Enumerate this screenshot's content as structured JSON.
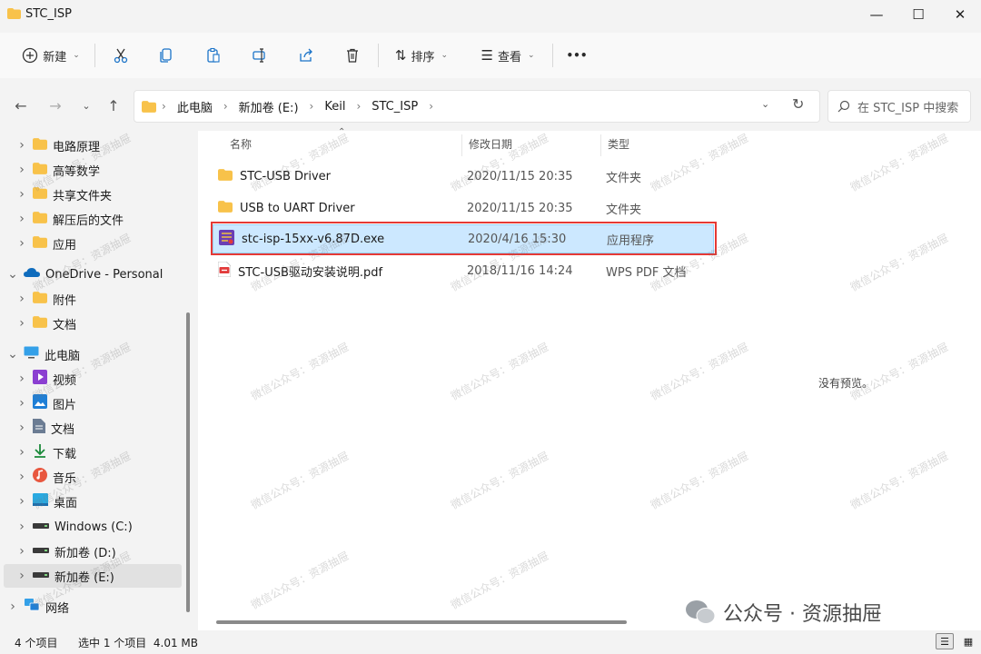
{
  "window": {
    "title": "STC_ISP",
    "minimize_icon": "—",
    "maximize_icon": "☐",
    "close_icon": "✕"
  },
  "toolbar": {
    "new_label": "新建",
    "sort_label": "排序",
    "view_label": "查看",
    "more_label": "•••"
  },
  "nav": {
    "breadcrumb": [
      "此电脑",
      "新加卷 (E:)",
      "Keil",
      "STC_ISP"
    ],
    "search_placeholder": "在 STC_ISP 中搜索"
  },
  "sidebar": {
    "items": [
      {
        "label": "电路原理",
        "icon": "folder-icon",
        "indent": 1,
        "expander": ">"
      },
      {
        "label": "高等数学",
        "icon": "folder-icon",
        "indent": 1,
        "expander": ">"
      },
      {
        "label": "共享文件夹",
        "icon": "folder-icon",
        "indent": 1,
        "expander": ">"
      },
      {
        "label": "解压后的文件",
        "icon": "folder-icon",
        "indent": 1,
        "expander": ">"
      },
      {
        "label": "应用",
        "icon": "folder-icon",
        "indent": 1,
        "expander": ">"
      },
      {
        "label": "OneDrive - Personal",
        "icon": "cloud-icon",
        "indent": 0,
        "expander": "v"
      },
      {
        "label": "附件",
        "icon": "folder-icon",
        "indent": 1,
        "expander": ">"
      },
      {
        "label": "文档",
        "icon": "folder-icon",
        "indent": 1,
        "expander": ">"
      },
      {
        "label": "此电脑",
        "icon": "monitor-icon",
        "indent": 0,
        "expander": "v"
      },
      {
        "label": "视频",
        "icon": "video-icon",
        "indent": 1,
        "expander": ">"
      },
      {
        "label": "图片",
        "icon": "picture-icon",
        "indent": 1,
        "expander": ">"
      },
      {
        "label": "文档",
        "icon": "document-icon",
        "indent": 1,
        "expander": ">"
      },
      {
        "label": "下载",
        "icon": "download-icon",
        "indent": 1,
        "expander": ">"
      },
      {
        "label": "音乐",
        "icon": "music-icon",
        "indent": 1,
        "expander": ">"
      },
      {
        "label": "桌面",
        "icon": "desktop-icon",
        "indent": 1,
        "expander": ">"
      },
      {
        "label": "Windows (C:)",
        "icon": "drive-icon",
        "indent": 1,
        "expander": ">"
      },
      {
        "label": "新加卷 (D:)",
        "icon": "drive-icon",
        "indent": 1,
        "expander": ">"
      },
      {
        "label": "新加卷 (E:)",
        "icon": "drive-icon",
        "indent": 1,
        "expander": ">",
        "selected": true
      },
      {
        "label": "网络",
        "icon": "network-icon",
        "indent": 0,
        "expander": ">"
      }
    ]
  },
  "columns": {
    "name": "名称",
    "modified": "修改日期",
    "type": "类型"
  },
  "files": [
    {
      "name": "STC-USB Driver",
      "modified": "2020/11/15 20:35",
      "type": "文件夹",
      "icon": "folder-icon"
    },
    {
      "name": "USB to UART Driver",
      "modified": "2020/11/15 20:35",
      "type": "文件夹",
      "icon": "folder-icon"
    },
    {
      "name": "stc-isp-15xx-v6.87D.exe",
      "modified": "2020/4/16 15:30",
      "type": "应用程序",
      "icon": "exe-icon",
      "selected": true
    },
    {
      "name": "STC-USB驱动安装说明.pdf",
      "modified": "2018/11/16 14:24",
      "type": "WPS PDF 文档",
      "icon": "pdf-icon"
    }
  ],
  "preview": {
    "empty_text": "没有预览。"
  },
  "status": {
    "item_count": "4 个项目",
    "selection": "选中 1 个项目  4.01 MB"
  },
  "watermark": {
    "text": "微信公众号：资源抽屉",
    "brand": "公众号 · 资源抽屉"
  },
  "colors": {
    "selection": "#cce8ff",
    "highlight_border": "#e53935",
    "folder": "#f8c24a"
  }
}
